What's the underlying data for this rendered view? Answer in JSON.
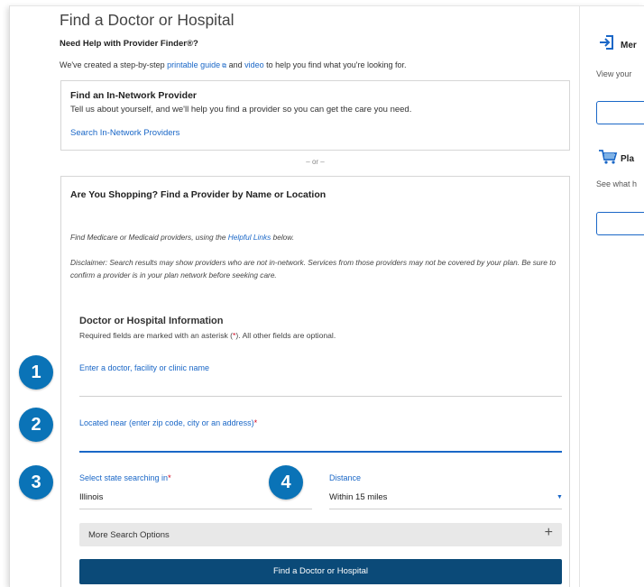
{
  "page": {
    "title": "Find a Doctor or Hospital",
    "help_title": "Need Help with Provider Finder®?",
    "help_prefix": "We've created a step-by-step ",
    "help_guide_link": "printable guide",
    "help_mid": " and ",
    "help_video_link": "video",
    "help_suffix": " to help you find what you're looking for."
  },
  "in_network": {
    "heading": "Find an In-Network Provider",
    "description": "Tell us about yourself, and we'll help you find a provider so you can get the care you need.",
    "link": "Search In-Network Providers"
  },
  "divider": "– or –",
  "shopping": {
    "heading": "Are You Shopping? Find a Provider by Name or Location",
    "medicare_prefix": "Find Medicare or Medicaid providers, using the ",
    "medicare_link": "Helpful Links",
    "medicare_suffix": " below.",
    "disclaimer": "Disclaimer: Search results may show providers who are not in-network. Services from those providers may not be covered by your plan. Be sure to confirm a provider is in your plan network before seeking care.",
    "section_heading": "Doctor or Hospital Information",
    "required_prefix": "Required fields are marked with an asterisk (",
    "asterisk": "*",
    "required_suffix": "). All other fields are optional."
  },
  "fields": {
    "name_label": "Enter a doctor, facility or clinic name",
    "name_value": "",
    "location_label": "Located near (enter zip code, city or an address)",
    "location_value": "",
    "state_label": "Select state searching in",
    "state_value": "Illinois",
    "distance_label": "Distance",
    "distance_value": "Within 15 miles"
  },
  "more_options": {
    "label": "More Search Options",
    "icon": "+"
  },
  "submit_label": "Find a Doctor or Hospital",
  "badges": [
    "1",
    "2",
    "3",
    "4"
  ],
  "sidebar": {
    "item1_title": "Mer",
    "item1_desc": "View your",
    "item2_title": "Pla",
    "item2_desc": "See what h"
  },
  "colors": {
    "accent": "#1a67c7",
    "badge": "#0a73b7",
    "button": "#0b4a78",
    "required": "#d0021b"
  }
}
